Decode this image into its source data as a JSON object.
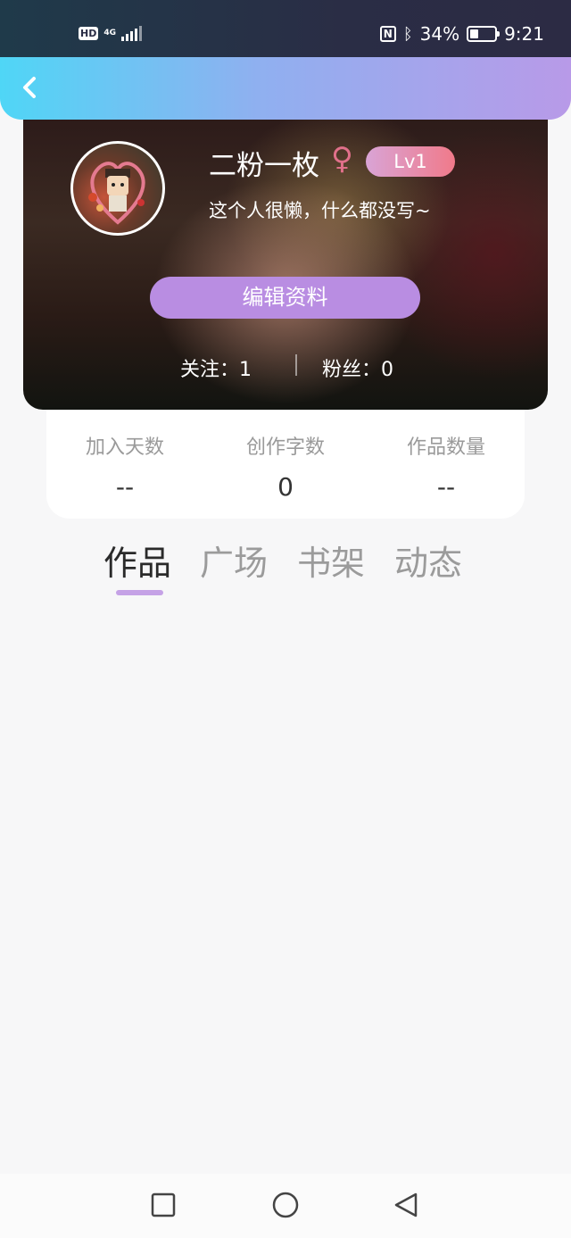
{
  "status_bar": {
    "hd": "HD",
    "network": "4G",
    "battery_percent": "34%",
    "time": "9:21",
    "icons": [
      "signal-icon",
      "nfc-icon",
      "bluetooth-icon",
      "battery-icon"
    ]
  },
  "header": {
    "back_icon": "chevron-left-icon"
  },
  "profile": {
    "username": "二粉一枚",
    "gender_symbol": "♀",
    "level": "Lv1",
    "bio": "这个人很懒，什么都没写~",
    "edit_button": "编辑资料",
    "follow_text": "关注：1",
    "fans_text": "粉丝：0"
  },
  "stats": [
    {
      "label": "加入天数",
      "value": "--"
    },
    {
      "label": "创作字数",
      "value": "0"
    },
    {
      "label": "作品数量",
      "value": "--"
    }
  ],
  "tabs": [
    {
      "label": "作品",
      "active": true
    },
    {
      "label": "广场",
      "active": false
    },
    {
      "label": "书架",
      "active": false
    },
    {
      "label": "动态",
      "active": false
    }
  ],
  "nav": {
    "icons": [
      "recent-apps-icon",
      "home-icon",
      "back-triangle-icon"
    ]
  },
  "colors": {
    "accent": "#b98de2",
    "header_start": "#4fd6f6",
    "header_end": "#b89ae8",
    "level_badge": "#f07a8a"
  }
}
